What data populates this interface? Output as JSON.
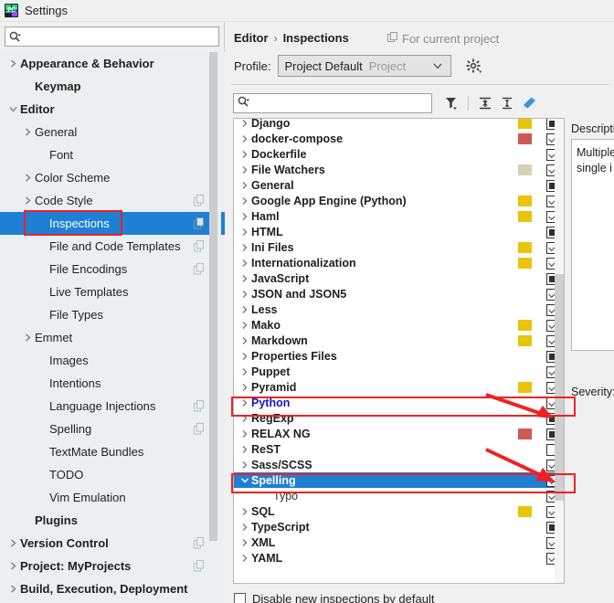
{
  "window": {
    "title": "Settings",
    "logo_icon": "pycharm-logo-icon",
    "logo_text": "PC"
  },
  "sidebar": {
    "search": {
      "value": "",
      "placeholder": "",
      "icon": "search-icon"
    },
    "items": [
      {
        "label": "Appearance & Behavior",
        "bold": true,
        "arrow": "chevron-right",
        "indent": 0,
        "copy": false,
        "selected": false
      },
      {
        "label": "Keymap",
        "bold": true,
        "arrow": "",
        "indent": 1,
        "copy": false,
        "selected": false
      },
      {
        "label": "Editor",
        "bold": true,
        "arrow": "chevron-down",
        "indent": 0,
        "copy": false,
        "selected": false
      },
      {
        "label": "General",
        "bold": false,
        "arrow": "chevron-right",
        "indent": 1,
        "copy": false,
        "selected": false
      },
      {
        "label": "Font",
        "bold": false,
        "arrow": "",
        "indent": 2,
        "copy": false,
        "selected": false
      },
      {
        "label": "Color Scheme",
        "bold": false,
        "arrow": "chevron-right",
        "indent": 1,
        "copy": false,
        "selected": false
      },
      {
        "label": "Code Style",
        "bold": false,
        "arrow": "chevron-right",
        "indent": 1,
        "copy": true,
        "selected": false
      },
      {
        "label": "Inspections",
        "bold": false,
        "arrow": "",
        "indent": 2,
        "copy": true,
        "selected": true
      },
      {
        "label": "File and Code Templates",
        "bold": false,
        "arrow": "",
        "indent": 2,
        "copy": true,
        "selected": false
      },
      {
        "label": "File Encodings",
        "bold": false,
        "arrow": "",
        "indent": 2,
        "copy": true,
        "selected": false
      },
      {
        "label": "Live Templates",
        "bold": false,
        "arrow": "",
        "indent": 2,
        "copy": false,
        "selected": false
      },
      {
        "label": "File Types",
        "bold": false,
        "arrow": "",
        "indent": 2,
        "copy": false,
        "selected": false
      },
      {
        "label": "Emmet",
        "bold": false,
        "arrow": "chevron-right",
        "indent": 1,
        "copy": false,
        "selected": false
      },
      {
        "label": "Images",
        "bold": false,
        "arrow": "",
        "indent": 2,
        "copy": false,
        "selected": false
      },
      {
        "label": "Intentions",
        "bold": false,
        "arrow": "",
        "indent": 2,
        "copy": false,
        "selected": false
      },
      {
        "label": "Language Injections",
        "bold": false,
        "arrow": "",
        "indent": 2,
        "copy": true,
        "selected": false
      },
      {
        "label": "Spelling",
        "bold": false,
        "arrow": "",
        "indent": 2,
        "copy": true,
        "selected": false
      },
      {
        "label": "TextMate Bundles",
        "bold": false,
        "arrow": "",
        "indent": 2,
        "copy": false,
        "selected": false
      },
      {
        "label": "TODO",
        "bold": false,
        "arrow": "",
        "indent": 2,
        "copy": false,
        "selected": false
      },
      {
        "label": "Vim Emulation",
        "bold": false,
        "arrow": "",
        "indent": 2,
        "copy": false,
        "selected": false
      },
      {
        "label": "Plugins",
        "bold": true,
        "arrow": "",
        "indent": 1,
        "copy": false,
        "selected": false
      },
      {
        "label": "Version Control",
        "bold": true,
        "arrow": "chevron-right",
        "indent": 0,
        "copy": true,
        "selected": false
      },
      {
        "label": "Project: MyProjects",
        "bold": true,
        "arrow": "chevron-right",
        "indent": 0,
        "copy": true,
        "selected": false
      },
      {
        "label": "Build, Execution, Deployment",
        "bold": true,
        "arrow": "chevron-right",
        "indent": 0,
        "copy": false,
        "selected": false
      }
    ]
  },
  "header": {
    "breadcrumb_parent": "Editor",
    "breadcrumb_sep": "›",
    "breadcrumb_current": "Inspections",
    "for_current_project": "For current project",
    "for_current_project_icon": "copy-icon",
    "profile_label": "Profile:",
    "profile_value": "Project Default",
    "profile_scope": "Project",
    "profile_chevron_icon": "chevron-down-icon",
    "gear_icon": "gear-icon"
  },
  "toolbar": {
    "search_value": "",
    "search_placeholder": "",
    "search_icon": "search-icon",
    "filter_icon": "filter-funnel-icon",
    "expand_all_icon": "expand-all-icon",
    "collapse_all_icon": "collapse-all-icon",
    "reset_icon": "reset-eraser-icon"
  },
  "colors": {
    "accent": "#1f7fd4",
    "annotation": "#ee2222",
    "swatch_yellow": "#e8c40a",
    "swatch_red": "#cc5a55",
    "swatch_tan": "#d8d2b4",
    "python_label": "#1414cc"
  },
  "inspections": {
    "rows": [
      {
        "label": "Django",
        "arrow": "chevron-right",
        "swatch": "#e8c40a",
        "check": "partial",
        "child": false,
        "selected": false,
        "highlight": false
      },
      {
        "label": "docker-compose",
        "arrow": "chevron-right",
        "swatch": "#cc5a55",
        "check": "checked",
        "child": false,
        "selected": false,
        "highlight": false
      },
      {
        "label": "Dockerfile",
        "arrow": "chevron-right",
        "swatch": "",
        "check": "checked",
        "child": false,
        "selected": false,
        "highlight": false
      },
      {
        "label": "File Watchers",
        "arrow": "chevron-right",
        "swatch": "#d8d2b4",
        "check": "checked",
        "child": false,
        "selected": false,
        "highlight": false
      },
      {
        "label": "General",
        "arrow": "chevron-right",
        "swatch": "",
        "check": "partial",
        "child": false,
        "selected": false,
        "highlight": false
      },
      {
        "label": "Google App Engine (Python)",
        "arrow": "chevron-right",
        "swatch": "#e8c40a",
        "check": "checked",
        "child": false,
        "selected": false,
        "highlight": false
      },
      {
        "label": "Haml",
        "arrow": "chevron-right",
        "swatch": "#e8c40a",
        "check": "checked",
        "child": false,
        "selected": false,
        "highlight": false
      },
      {
        "label": "HTML",
        "arrow": "chevron-right",
        "swatch": "",
        "check": "partial",
        "child": false,
        "selected": false,
        "highlight": false
      },
      {
        "label": "Ini Files",
        "arrow": "chevron-right",
        "swatch": "#e8c40a",
        "check": "checked",
        "child": false,
        "selected": false,
        "highlight": false
      },
      {
        "label": "Internationalization",
        "arrow": "chevron-right",
        "swatch": "#e8c40a",
        "check": "checked",
        "child": false,
        "selected": false,
        "highlight": false
      },
      {
        "label": "JavaScript",
        "arrow": "chevron-right",
        "swatch": "",
        "check": "partial",
        "child": false,
        "selected": false,
        "highlight": false
      },
      {
        "label": "JSON and JSON5",
        "arrow": "chevron-right",
        "swatch": "",
        "check": "checked",
        "child": false,
        "selected": false,
        "highlight": false
      },
      {
        "label": "Less",
        "arrow": "chevron-right",
        "swatch": "",
        "check": "checked",
        "child": false,
        "selected": false,
        "highlight": false
      },
      {
        "label": "Mako",
        "arrow": "chevron-right",
        "swatch": "#e8c40a",
        "check": "checked",
        "child": false,
        "selected": false,
        "highlight": false
      },
      {
        "label": "Markdown",
        "arrow": "chevron-right",
        "swatch": "#e8c40a",
        "check": "checked",
        "child": false,
        "selected": false,
        "highlight": false
      },
      {
        "label": "Properties Files",
        "arrow": "chevron-right",
        "swatch": "",
        "check": "partial",
        "child": false,
        "selected": false,
        "highlight": false
      },
      {
        "label": "Puppet",
        "arrow": "chevron-right",
        "swatch": "",
        "check": "checked",
        "child": false,
        "selected": false,
        "highlight": false
      },
      {
        "label": "Pyramid",
        "arrow": "chevron-right",
        "swatch": "#e8c40a",
        "check": "checked",
        "child": false,
        "selected": false,
        "highlight": false
      },
      {
        "label": "Python",
        "arrow": "chevron-right",
        "swatch": "",
        "check": "checked",
        "child": false,
        "selected": false,
        "highlight": true
      },
      {
        "label": "RegExp",
        "arrow": "chevron-right",
        "swatch": "",
        "check": "partial",
        "child": false,
        "selected": false,
        "highlight": false
      },
      {
        "label": "RELAX NG",
        "arrow": "chevron-right",
        "swatch": "#cc5a55",
        "check": "partial",
        "child": false,
        "selected": false,
        "highlight": false
      },
      {
        "label": "ReST",
        "arrow": "chevron-right",
        "swatch": "",
        "check": "unchecked",
        "child": false,
        "selected": false,
        "highlight": false
      },
      {
        "label": "Sass/SCSS",
        "arrow": "chevron-right",
        "swatch": "",
        "check": "checked",
        "child": false,
        "selected": false,
        "highlight": false
      },
      {
        "label": "Spelling",
        "arrow": "chevron-down",
        "swatch": "",
        "check": "checked",
        "child": false,
        "selected": true,
        "highlight": false
      },
      {
        "label": "Typo",
        "arrow": "",
        "swatch": "",
        "check": "checked",
        "child": true,
        "selected": false,
        "highlight": false
      },
      {
        "label": "SQL",
        "arrow": "chevron-right",
        "swatch": "#e8c40a",
        "check": "checked",
        "child": false,
        "selected": false,
        "highlight": false
      },
      {
        "label": "TypeScript",
        "arrow": "chevron-right",
        "swatch": "",
        "check": "partial",
        "child": false,
        "selected": false,
        "highlight": false
      },
      {
        "label": "XML",
        "arrow": "chevron-right",
        "swatch": "",
        "check": "checked",
        "child": false,
        "selected": false,
        "highlight": false
      },
      {
        "label": "YAML",
        "arrow": "chevron-right",
        "swatch": "",
        "check": "checked",
        "child": false,
        "selected": false,
        "highlight": false
      }
    ],
    "disable_new_label": "Disable new inspections by default",
    "disable_new_checked": false
  },
  "detail": {
    "description_title": "Description",
    "description_line1": "Multiple",
    "description_line2": "single i",
    "severity_label": "Severity:"
  }
}
